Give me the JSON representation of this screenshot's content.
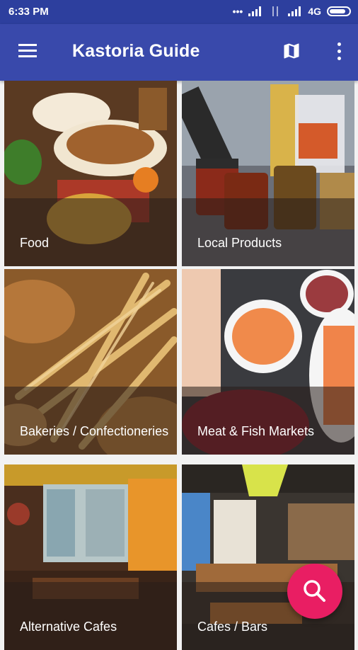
{
  "status_bar": {
    "time": "6:33 PM",
    "network": "4G"
  },
  "app_bar": {
    "title": "Kastoria Guide"
  },
  "categories": [
    {
      "label": "Food"
    },
    {
      "label": "Local Products"
    },
    {
      "label": "Bakeries / Confectioneries"
    },
    {
      "label": "Meat & Fish Markets"
    },
    {
      "label": "Alternative Cafes"
    },
    {
      "label": "Cafes / Bars"
    }
  ],
  "icons": {
    "menu": "menu-icon",
    "map": "map-icon",
    "more": "more-vertical-icon",
    "search": "search-icon"
  },
  "colors": {
    "status_bar": "#2d3f9e",
    "app_bar": "#3949ab",
    "fab": "#e91e63"
  }
}
